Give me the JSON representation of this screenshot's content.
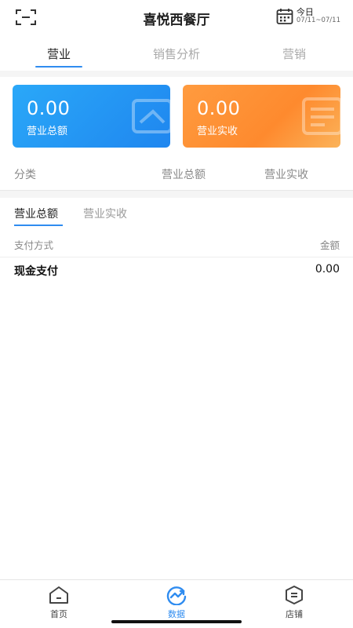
{
  "header": {
    "title": "喜悦西餐厅",
    "date_label": "今日",
    "date_range": "07/11~07/11"
  },
  "top_tabs": [
    {
      "label": "营业",
      "active": true
    },
    {
      "label": "销售分析",
      "active": false
    },
    {
      "label": "营销",
      "active": false
    }
  ],
  "cards": {
    "total": {
      "value": "0.00",
      "label": "营业总额"
    },
    "actual": {
      "value": "0.00",
      "label": "营业实收"
    }
  },
  "category_header": {
    "col1": "分类",
    "col2": "营业总额",
    "col3": "营业实收"
  },
  "sub_tabs": [
    {
      "label": "营业总额",
      "active": true
    },
    {
      "label": "营业实收",
      "active": false
    }
  ],
  "payment_table": {
    "headers": [
      "支付方式",
      "金额"
    ],
    "rows": [
      {
        "method": "现金支付",
        "amount": "0.00"
      }
    ]
  },
  "bottom_nav": [
    {
      "label": "首页",
      "icon": "home-icon",
      "active": false
    },
    {
      "label": "数据",
      "icon": "data-chart-icon",
      "active": true
    },
    {
      "label": "店铺",
      "icon": "shop-icon",
      "active": false
    }
  ],
  "colors": {
    "accent": "#2f8cf0",
    "card_blue": "#1f86ef",
    "card_orange": "#fe8a2e"
  }
}
